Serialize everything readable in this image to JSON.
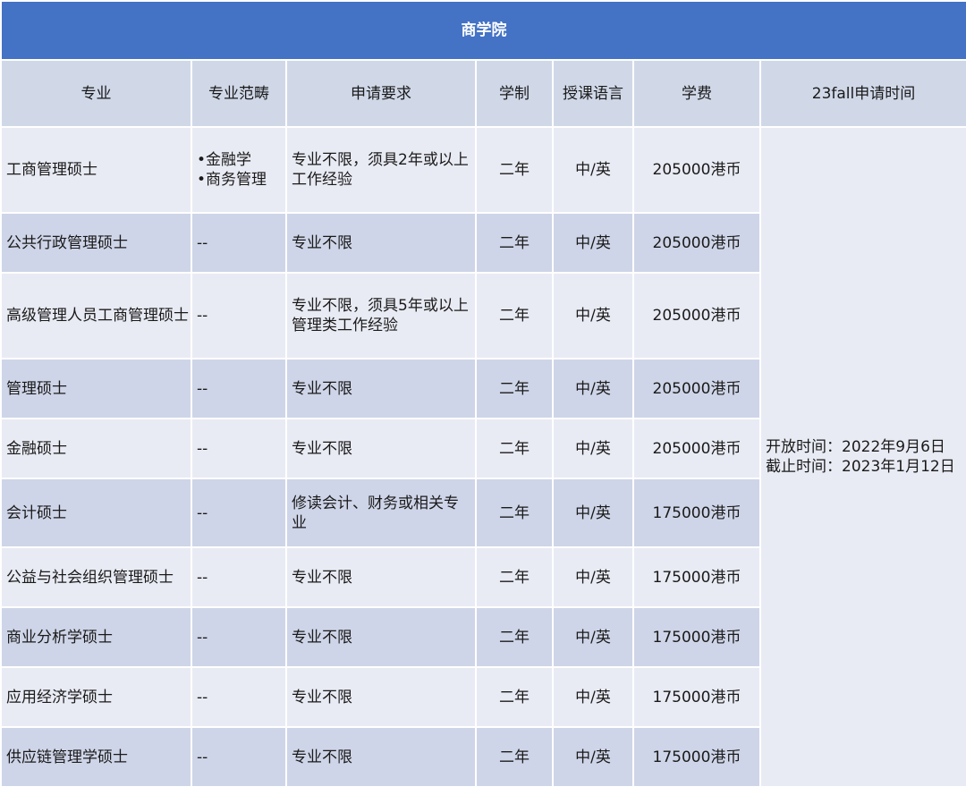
{
  "title": "商学院",
  "headers": {
    "program": "专业",
    "scope": "专业范畴",
    "requirements": "申请要求",
    "duration": "学制",
    "language": "授课语言",
    "tuition": "学费",
    "application_period": "23fall申请时间"
  },
  "rows": [
    {
      "program": "工商管理硕士",
      "scope": [
        "•金融学",
        "•商务管理"
      ],
      "requirements": [
        "专业不限，须具2年或以上",
        "工作经验"
      ],
      "duration": "二年",
      "language": "中/英",
      "tuition": "205000港币"
    },
    {
      "program": "公共行政管理硕士",
      "scope": [
        "--"
      ],
      "requirements": [
        "专业不限"
      ],
      "duration": "二年",
      "language": "中/英",
      "tuition": "205000港币"
    },
    {
      "program": "高级管理人员工商管理硕士",
      "scope": [
        "--"
      ],
      "requirements": [
        "专业不限，须具5年或以上",
        "管理类工作经验"
      ],
      "duration": "二年",
      "language": "中/英",
      "tuition": "205000港币"
    },
    {
      "program": "管理硕士",
      "scope": [
        "--"
      ],
      "requirements": [
        "专业不限"
      ],
      "duration": "二年",
      "language": "中/英",
      "tuition": "205000港币"
    },
    {
      "program": "金融硕士",
      "scope": [
        "--"
      ],
      "requirements": [
        "专业不限"
      ],
      "duration": "二年",
      "language": "中/英",
      "tuition": "205000港币"
    },
    {
      "program": "会计硕士",
      "scope": [
        "--"
      ],
      "requirements": [
        "修读会计、财务或相关专业"
      ],
      "duration": "二年",
      "language": "中/英",
      "tuition": "175000港币"
    },
    {
      "program": "公益与社会组织管理硕士",
      "scope": [
        "--"
      ],
      "requirements": [
        "专业不限"
      ],
      "duration": "二年",
      "language": "中/英",
      "tuition": "175000港币"
    },
    {
      "program": "商业分析学硕士",
      "scope": [
        "--"
      ],
      "requirements": [
        "专业不限"
      ],
      "duration": "二年",
      "language": "中/英",
      "tuition": "175000港币"
    },
    {
      "program": "应用经济学硕士",
      "scope": [
        "--"
      ],
      "requirements": [
        "专业不限"
      ],
      "duration": "二年",
      "language": "中/英",
      "tuition": "175000港币"
    },
    {
      "program": "供应链管理学硕士",
      "scope": [
        "--"
      ],
      "requirements": [
        "专业不限"
      ],
      "duration": "二年",
      "language": "中/英",
      "tuition": "175000港币"
    }
  ],
  "application_period": {
    "open": "开放时间：2022年9月6日",
    "close": "截止时间：2023年1月12日"
  },
  "colors": {
    "title_bg": "#4472c4",
    "header_bg": "#d0d8e8",
    "row_dark": "#cfd5e8",
    "row_light": "#e9ebf4"
  }
}
